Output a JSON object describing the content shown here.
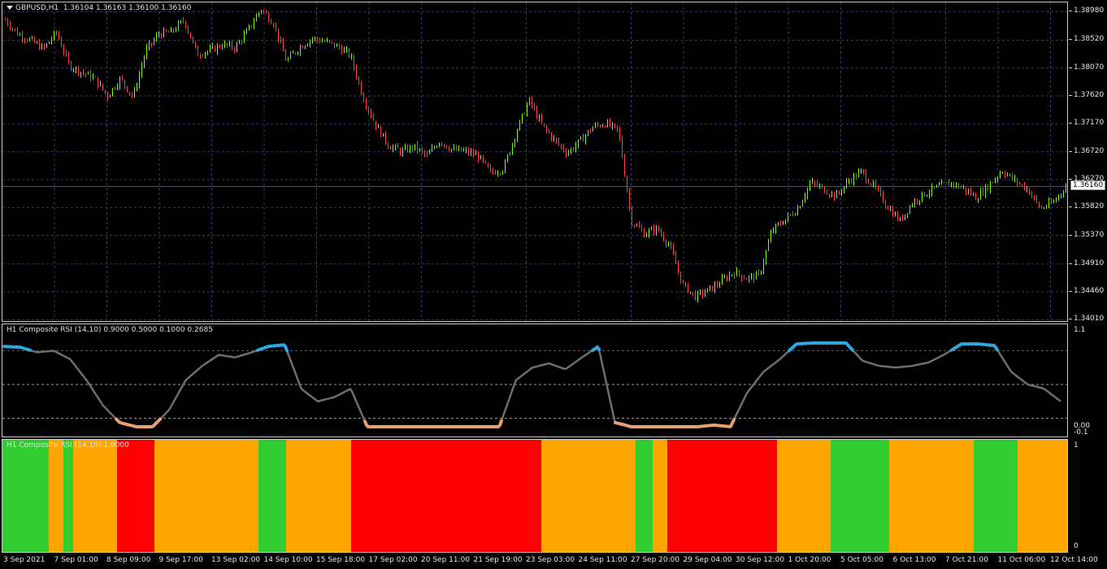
{
  "chart": {
    "symbol_label": "GBPUSD,H1",
    "ohlc": "1.36104 1.36163 1.36100 1.36160",
    "current_price": "1.36160",
    "price_levels": [
      "1.38980",
      "1.38520",
      "1.38070",
      "1.37620",
      "1.37170",
      "1.36720",
      "1.36270",
      "1.35820",
      "1.35370",
      "1.34910",
      "1.34460",
      "1.34010"
    ]
  },
  "rsi_panel": {
    "label": "H1 Composite RSI (14,10) 0.9000 0.5000 0.1000 0.2685",
    "levels": [
      "1.1",
      "0.00",
      "-0.1"
    ]
  },
  "state_panel": {
    "label": "H1 Composite RSI (14,10) 1.0000",
    "levels": [
      "1",
      "0"
    ]
  },
  "time_axis": [
    "3 Sep 2021",
    "7 Sep 01:00",
    "8 Sep 09:00",
    "9 Sep 17:00",
    "13 Sep 02:00",
    "14 Sep 10:00",
    "15 Sep 18:00",
    "17 Sep 02:00",
    "20 Sep 11:00",
    "21 Sep 19:00",
    "23 Sep 03:00",
    "24 Sep 11:00",
    "27 Sep 20:00",
    "29 Sep 04:00",
    "30 Sep 12:00",
    "1 Oct 20:00",
    "5 Oct 05:00",
    "6 Oct 13:00",
    "7 Oct 21:00",
    "11 Oct 06:00",
    "12 Oct 14:00"
  ],
  "colors": {
    "bull": "#7cfc00",
    "bear": "#ff3b3b",
    "grid": "#2a3a7a",
    "rsi_line": "#6e6e6e",
    "rsi_high": "#2fa8e0",
    "rsi_low": "#e8a070",
    "state_green": "#32cd32",
    "state_orange": "#ffa500",
    "state_red": "#ff0000"
  },
  "chart_data": {
    "type": "candlestick",
    "price_path": [
      1.3885,
      1.3862,
      1.3852,
      1.3838,
      1.3865,
      1.3812,
      1.38,
      1.379,
      1.3762,
      1.379,
      1.376,
      1.3835,
      1.3862,
      1.3865,
      1.3885,
      1.383,
      1.3835,
      1.3845,
      1.384,
      1.3868,
      1.3903,
      1.388,
      1.3818,
      1.384,
      1.3855,
      1.385,
      1.3842,
      1.3828,
      1.376,
      1.3715,
      1.3682,
      1.3672,
      1.368,
      1.3665,
      1.369,
      1.3675,
      1.3673,
      1.3665,
      1.3638,
      1.3645,
      1.3705,
      1.3755,
      1.3715,
      1.369,
      1.367,
      1.369,
      1.3712,
      1.3718,
      1.3705,
      1.356,
      1.354,
      1.3548,
      1.352,
      1.3458,
      1.3438,
      1.3448,
      1.3462,
      1.3478,
      1.3468,
      1.3472,
      1.3545,
      1.3562,
      1.358,
      1.3622,
      1.3612,
      1.36,
      1.3625,
      1.364,
      1.3615,
      1.3585,
      1.356,
      1.359,
      1.3605,
      1.3615,
      1.3622,
      1.3612,
      1.3598,
      1.3618,
      1.3642,
      1.3625,
      1.3612,
      1.358,
      1.359,
      1.3616
    ],
    "rsi_path": [
      0.95,
      0.94,
      0.88,
      0.9,
      0.8,
      0.55,
      0.25,
      0.05,
      0.0,
      0.0,
      0.2,
      0.55,
      0.72,
      0.85,
      0.82,
      0.88,
      0.95,
      0.97,
      0.45,
      0.3,
      0.35,
      0.45,
      0.0,
      0.0,
      0.0,
      0.0,
      0.0,
      0.0,
      0.0,
      0.0,
      0.0,
      0.55,
      0.7,
      0.75,
      0.68,
      0.82,
      0.95,
      0.05,
      0.0,
      0.0,
      0.0,
      0.0,
      0.0,
      0.02,
      0.0,
      0.4,
      0.65,
      0.8,
      0.98,
      0.99,
      0.99,
      0.99,
      0.78,
      0.72,
      0.7,
      0.72,
      0.76,
      0.86,
      0.98,
      0.98,
      0.96,
      0.65,
      0.5,
      0.45,
      0.3
    ],
    "states": [
      {
        "state": "green",
        "from": 0,
        "to": 57
      },
      {
        "state": "orange",
        "from": 57,
        "to": 75
      },
      {
        "state": "green",
        "from": 75,
        "to": 87
      },
      {
        "state": "orange",
        "from": 87,
        "to": 141
      },
      {
        "state": "red",
        "from": 141,
        "to": 187
      },
      {
        "state": "orange",
        "from": 187,
        "to": 315
      },
      {
        "state": "green",
        "from": 315,
        "to": 349
      },
      {
        "state": "orange",
        "from": 349,
        "to": 429
      },
      {
        "state": "red",
        "from": 429,
        "to": 663
      },
      {
        "state": "orange",
        "from": 663,
        "to": 779
      },
      {
        "state": "green",
        "from": 779,
        "to": 800
      },
      {
        "state": "orange",
        "from": 800,
        "to": 818
      },
      {
        "state": "red",
        "from": 818,
        "to": 953
      },
      {
        "state": "orange",
        "from": 953,
        "to": 1019
      },
      {
        "state": "green",
        "from": 1019,
        "to": 1091
      },
      {
        "state": "orange",
        "from": 1091,
        "to": 1195
      },
      {
        "state": "green",
        "from": 1195,
        "to": 1249
      },
      {
        "state": "orange",
        "from": 1249,
        "to": 1310
      }
    ]
  }
}
